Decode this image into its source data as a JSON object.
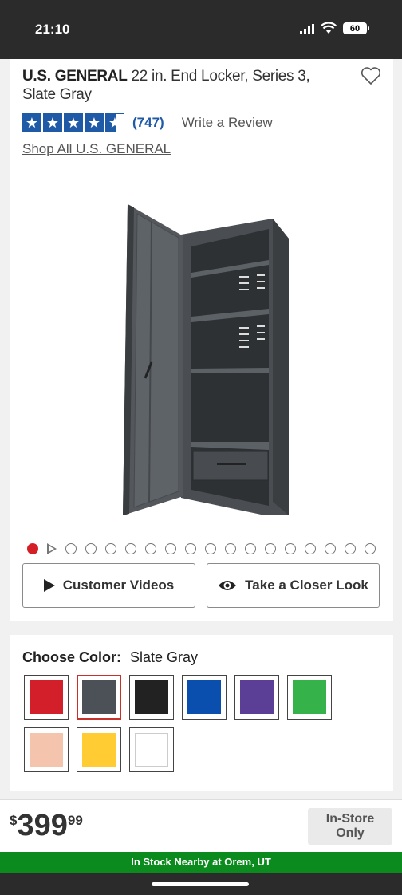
{
  "status": {
    "time": "21:10",
    "battery": "60"
  },
  "product": {
    "brand": "U.S. GENERAL",
    "name": " 22 in. End Locker, Series 3, Slate Gray",
    "rating": 4.5,
    "review_count": "(747)",
    "write_review": "Write a Review",
    "shop_all": "Shop All U.S. GENERAL"
  },
  "gallery": {
    "total_dots": 18,
    "active_index": 0
  },
  "buttons": {
    "customer_videos": "Customer Videos",
    "closer_look": "Take a Closer Look"
  },
  "color": {
    "label": "Choose Color:",
    "selected": "Slate Gray",
    "swatches": [
      {
        "name": "red",
        "color": "#d21f2a"
      },
      {
        "name": "slate-gray",
        "color": "#4b5157"
      },
      {
        "name": "black",
        "color": "#222222"
      },
      {
        "name": "blue",
        "color": "#0a4fad"
      },
      {
        "name": "purple",
        "color": "#5b3f96"
      },
      {
        "name": "green",
        "color": "#35b24a"
      },
      {
        "name": "pink",
        "color": "#f5c4ad"
      },
      {
        "name": "yellow",
        "color": "#ffcc33"
      },
      {
        "name": "white",
        "color": "#ffffff"
      }
    ]
  },
  "pricing": {
    "currency": "$",
    "dollars": "399",
    "cents": "99",
    "availability_line1": "In-Store",
    "availability_line2": "Only"
  },
  "stock": {
    "message": "In Stock Nearby at Orem, UT"
  },
  "colors": {
    "brand_blue": "#1f5aa6",
    "accent_red": "#d41f26",
    "stock_green": "#0b8a1e"
  }
}
